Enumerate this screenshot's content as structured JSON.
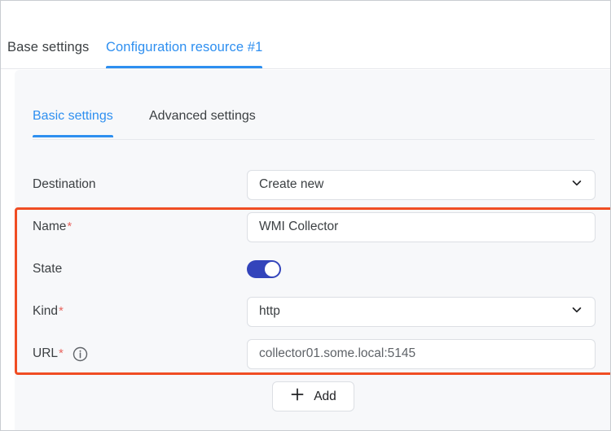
{
  "tabs": [
    {
      "label": "Base settings",
      "active": false
    },
    {
      "label": "Configuration resource #1",
      "active": true
    }
  ],
  "subtabs": [
    {
      "label": "Basic settings",
      "active": true
    },
    {
      "label": "Advanced settings",
      "active": false
    }
  ],
  "form": {
    "destination": {
      "label": "Destination",
      "required": false,
      "control": "select",
      "value": "Create new"
    },
    "name": {
      "label": "Name",
      "required_marker": "*",
      "control": "text",
      "value": "WMI Collector"
    },
    "state": {
      "label": "State",
      "control": "toggle",
      "value": "on"
    },
    "kind": {
      "label": "Kind",
      "required_marker": "*",
      "control": "select",
      "value": "http"
    },
    "url": {
      "label": "URL",
      "required_marker": "*",
      "control": "text",
      "value": "collector01.some.local:5145",
      "info_icon": "info-icon"
    }
  },
  "add_button": {
    "label": "Add",
    "icon": "plus-icon"
  },
  "icons": {
    "chevron": "chevron-down-icon",
    "info": "info-circle-icon",
    "plus": "plus-icon"
  },
  "colors": {
    "accent_blue": "#2e8ff0",
    "highlight_orange": "#f04d23",
    "toggle_on": "#3344bb",
    "required_red": "#e8655f",
    "panel_bg": "#f7f8fa"
  }
}
